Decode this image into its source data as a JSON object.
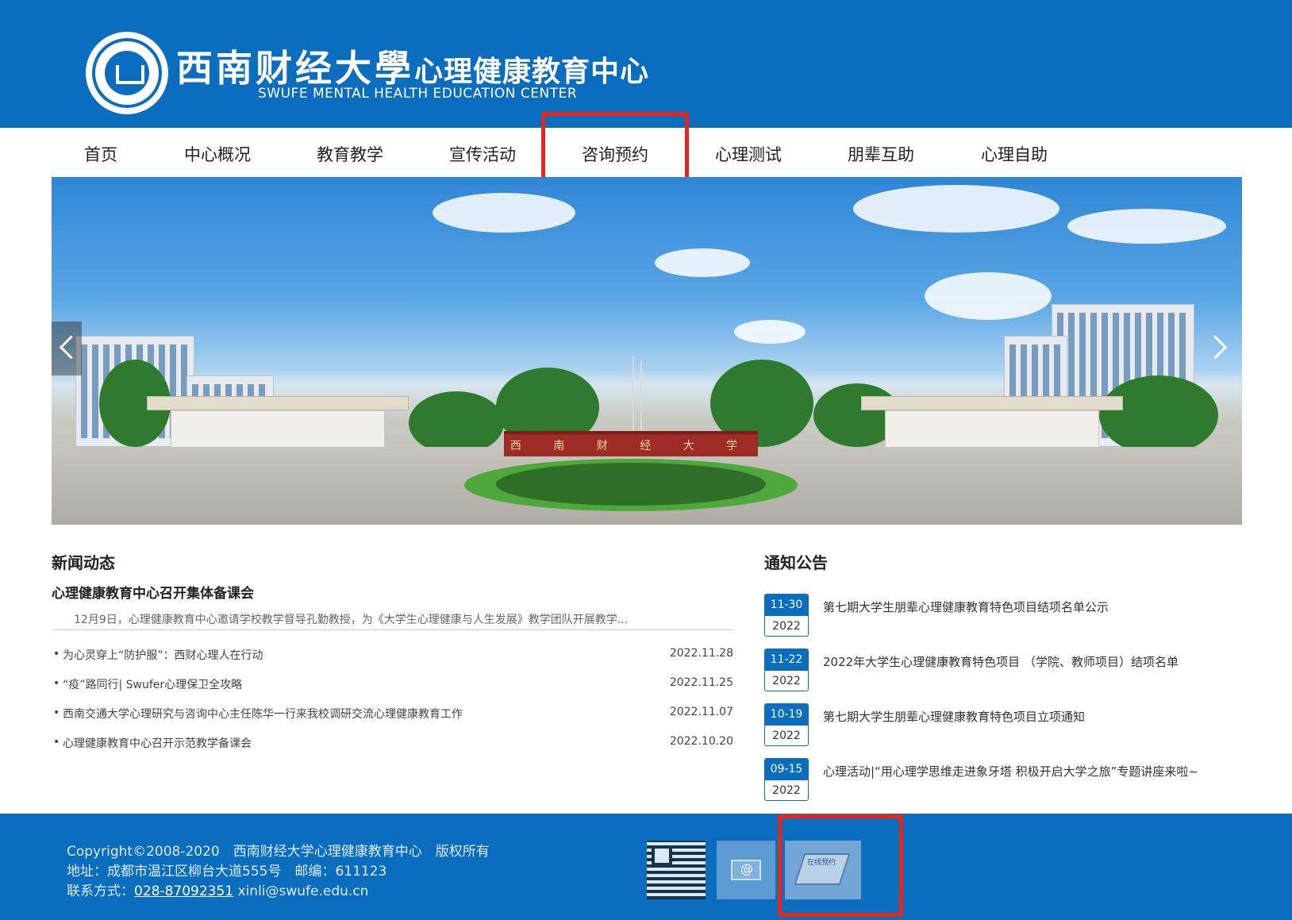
{
  "header": {
    "logo_cn_name": "西南财经大學",
    "logo_cn_center": "心理健康教育中心",
    "logo_en": "SWUFE MENTAL HEALTH EDUCATION CENTER"
  },
  "nav": {
    "items": [
      "首页",
      "中心概况",
      "教育教学",
      "宣传活动",
      "咨询预约",
      "心理测试",
      "朋辈互助",
      "心理自助"
    ],
    "highlighted": "咨询预约"
  },
  "banner": {
    "gate_text": "西 南 财 经 大 学"
  },
  "news": {
    "title": "新闻动态",
    "headline": "心理健康教育中心召开集体备课会",
    "summary": "12月9日，心理健康教育中心邀请学校教学督导孔勤教授，为《大学生心理健康与人生发展》教学团队开展教学...",
    "bullet": "•",
    "items": [
      {
        "title": "为心灵穿上“防护服”：西财心理人在行动",
        "date": "2022.11.28"
      },
      {
        "title": "“疫”路同行| Swufer心理保卫全攻略",
        "date": "2022.11.25"
      },
      {
        "title": "西南交通大学心理研究与咨询中心主任陈华一行来我校调研交流心理健康教育工作",
        "date": "2022.11.07"
      },
      {
        "title": "心理健康教育中心召开示范教学备课会",
        "date": "2022.10.20"
      }
    ]
  },
  "notices": {
    "title": "通知公告",
    "items": [
      {
        "md": "11-30",
        "year": "2022",
        "title": "第七期大学生朋辈心理健康教育特色项目结项名单公示"
      },
      {
        "md": "11-22",
        "year": "2022",
        "title": "2022年大学生心理健康教育特色项目 （学院、教师项目）结项名单"
      },
      {
        "md": "10-19",
        "year": "2022",
        "title": "第七期大学生朋辈心理健康教育特色项目立项通知"
      },
      {
        "md": "09-15",
        "year": "2022",
        "title": "心理活动|“用心理学思维走进象牙塔 积极开启大学之旅”专题讲座来啦~"
      }
    ]
  },
  "footer": {
    "copyright": "Copyright©2008-2020　西南财经大学心理健康教育中心　版权所有",
    "address": "地址：成都市温江区柳台大道555号　邮编：611123",
    "contact_label": "联系方式：",
    "phone": "028-87092351",
    "email": " xinli@swufe.edu.cn",
    "booking_image_text": "在线预约"
  },
  "colors": {
    "brand_blue": "#0b6dbd",
    "highlight_red": "#e8231a"
  },
  "icons": [
    "university-seal-icon",
    "qr-code-icon",
    "mail-icon",
    "online-booking-icon",
    "chevron-left-icon",
    "chevron-right-icon"
  ]
}
